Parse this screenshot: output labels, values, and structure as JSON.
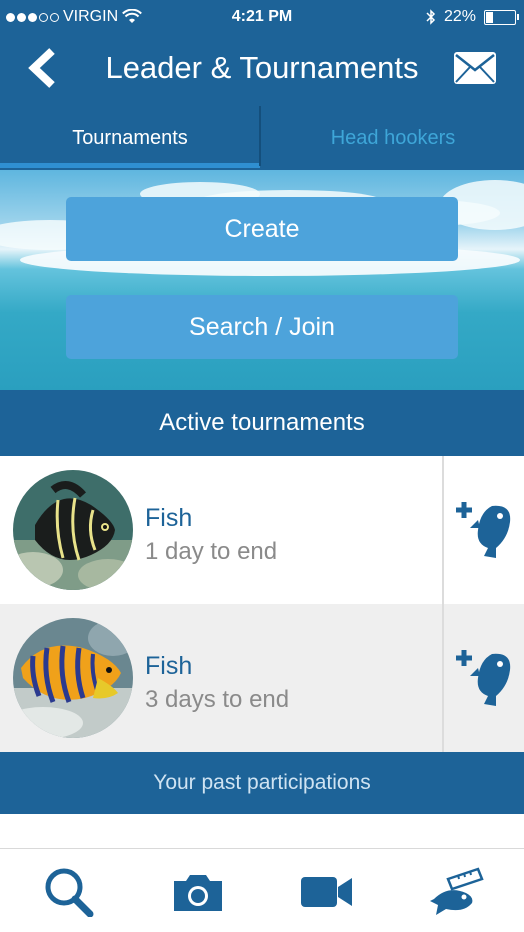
{
  "status_bar": {
    "carrier": "VIRGIN",
    "time": "4:21 PM",
    "battery": "22%",
    "battery_level": 0.22
  },
  "header": {
    "title": "Leader & Tournaments",
    "back_icon": "chevron-left-icon",
    "message_icon": "envelope-icon"
  },
  "tabs": [
    {
      "label": "Tournaments",
      "active": true
    },
    {
      "label": "Head hookers",
      "active": false
    }
  ],
  "actions": {
    "create_label": "Create",
    "search_join_label": "Search / Join"
  },
  "active_tournaments": {
    "heading": "Active tournaments",
    "items": [
      {
        "name": "Fish",
        "remaining": "1 day to end",
        "action_icon": "add-fish-icon"
      },
      {
        "name": "Fish",
        "remaining": "3 days to end",
        "action_icon": "add-fish-icon"
      }
    ]
  },
  "past": {
    "heading": "Your past participations"
  },
  "bottom_nav": [
    {
      "icon": "search-icon"
    },
    {
      "icon": "camera-icon"
    },
    {
      "icon": "video-camera-icon"
    },
    {
      "icon": "fish-measure-icon"
    }
  ],
  "colors": {
    "primary": "#1d6398",
    "button": "#4da3db",
    "inactive_tab": "#3ea6d8",
    "row_alt": "#efefef"
  }
}
